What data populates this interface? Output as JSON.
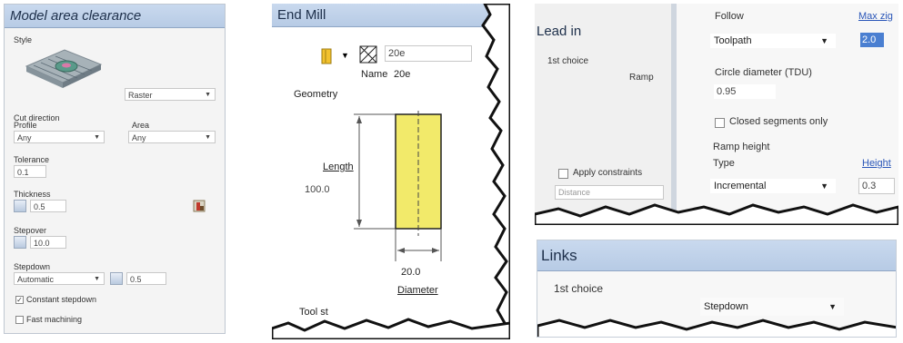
{
  "model_area": {
    "title": "Model area clearance",
    "style_label": "Style",
    "style_value": "Raster",
    "cut_direction_label": "Cut direction",
    "profile_label": "Profile",
    "profile_value": "Any",
    "area_label": "Area",
    "area_value": "Any",
    "tolerance_label": "Tolerance",
    "tolerance_value": "0.1",
    "thickness_label": "Thickness",
    "thickness_value": "0.5",
    "stepover_label": "Stepover",
    "stepover_value": "10.0",
    "stepdown_label": "Stepdown",
    "stepdown_mode": "Automatic",
    "stepdown_value": "0.5",
    "constant_stepdown_label": "Constant stepdown",
    "fast_machining_label": "Fast machining"
  },
  "end_mill": {
    "title": "End Mill",
    "tool_id": "20e",
    "name_label": "Name",
    "name_value": "20e",
    "geometry_label": "Geometry",
    "length_label": "Length",
    "length_value": "100.0",
    "diameter_value": "20.0",
    "diameter_label": "Diameter",
    "tool_state_label": "Tool st"
  },
  "lead_in": {
    "title": "Lead in",
    "first_choice_label": "1st choice",
    "first_choice_value": "Ramp",
    "apply_constraints_label": "Apply constraints",
    "distance_placeholder": "Distance",
    "follow_label": "Follow",
    "follow_value": "Toolpath",
    "max_zig_label": "Max zig",
    "max_zig_value": "2.0",
    "circle_diameter_label": "Circle diameter (TDU)",
    "circle_diameter_value": "0.95",
    "closed_segments_label": "Closed segments only",
    "ramp_height_label": "Ramp height",
    "type_label": "Type",
    "type_value": "Incremental",
    "height_label": "Height",
    "height_value": "0.3"
  },
  "links": {
    "title": "Links",
    "first_choice_label": "1st choice",
    "first_choice_value": "Stepdown"
  }
}
